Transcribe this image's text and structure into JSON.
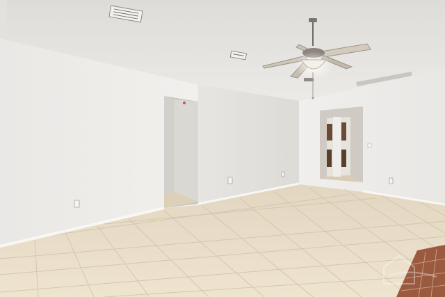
{
  "scene": {
    "description_free": true,
    "palette": {
      "ceiling": "#e6e4e0",
      "wall_left": "#ecebe8",
      "wall_center": "#e4e2de",
      "wall_right": "#efeeec",
      "floor": "#e8dcc6",
      "grout": "#cdbfa6",
      "baseboard": "#f7f6f3",
      "doorway_dark": "#b9b6b0",
      "fan_metal": "#6f6a63",
      "fan_blade": "#cfc6ba",
      "fan_glass": "#f2efe8",
      "brick": "#9a5a40"
    },
    "watermark": "logo"
  }
}
